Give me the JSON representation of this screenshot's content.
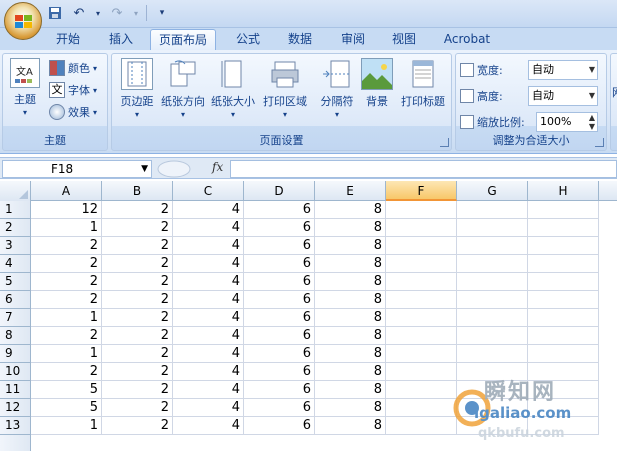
{
  "tabs": [
    "开始",
    "插入",
    "页面布局",
    "公式",
    "数据",
    "审阅",
    "视图",
    "Acrobat"
  ],
  "active_tab": "页面布局",
  "ribbon": {
    "theme_group": {
      "label": "主题",
      "themes_button": "主题",
      "colors": "颜色",
      "fonts": "字体",
      "effects": "效果"
    },
    "page_setup_group": {
      "label": "页面设置",
      "margins": "页边距",
      "orientation": "纸张方向",
      "size": "纸张大小",
      "print_area": "打印区域",
      "breaks": "分隔符",
      "background": "背景",
      "print_titles": "打印标题"
    },
    "scale_group": {
      "label": "调整为合适大小",
      "width_label": "宽度:",
      "width_value": "自动",
      "height_label": "高度:",
      "height_value": "自动",
      "scale_label": "缩放比例:",
      "scale_value": "100%"
    },
    "partial_group_letter": "网"
  },
  "formula_bar": {
    "name_box": "F18",
    "fx": "fx",
    "formula": ""
  },
  "columns": [
    "A",
    "B",
    "C",
    "D",
    "E",
    "F",
    "G",
    "H"
  ],
  "selected_column": "F",
  "rows": [
    {
      "n": "1",
      "A": "12",
      "B": "2",
      "C": "4",
      "D": "6",
      "E": "8"
    },
    {
      "n": "2",
      "A": "1",
      "B": "2",
      "C": "4",
      "D": "6",
      "E": "8"
    },
    {
      "n": "3",
      "A": "2",
      "B": "2",
      "C": "4",
      "D": "6",
      "E": "8"
    },
    {
      "n": "4",
      "A": "2",
      "B": "2",
      "C": "4",
      "D": "6",
      "E": "8"
    },
    {
      "n": "5",
      "A": "2",
      "B": "2",
      "C": "4",
      "D": "6",
      "E": "8"
    },
    {
      "n": "6",
      "A": "2",
      "B": "2",
      "C": "4",
      "D": "6",
      "E": "8"
    },
    {
      "n": "7",
      "A": "1",
      "B": "2",
      "C": "4",
      "D": "6",
      "E": "8"
    },
    {
      "n": "8",
      "A": "2",
      "B": "2",
      "C": "4",
      "D": "6",
      "E": "8"
    },
    {
      "n": "9",
      "A": "1",
      "B": "2",
      "C": "4",
      "D": "6",
      "E": "8"
    },
    {
      "n": "10",
      "A": "2",
      "B": "2",
      "C": "4",
      "D": "6",
      "E": "8"
    },
    {
      "n": "11",
      "A": "5",
      "B": "2",
      "C": "4",
      "D": "6",
      "E": "8"
    },
    {
      "n": "12",
      "A": "5",
      "B": "2",
      "C": "4",
      "D": "6",
      "E": "8"
    },
    {
      "n": "13",
      "A": "1",
      "B": "2",
      "C": "4",
      "D": "6",
      "E": "8"
    }
  ],
  "watermark": {
    "line1": "瞬知网",
    "line2": "igaliao.com",
    "line3": "qkbufu.com"
  },
  "colors": {
    "ribbon_text": "#15428b",
    "selected_header": "#f8c76a"
  }
}
